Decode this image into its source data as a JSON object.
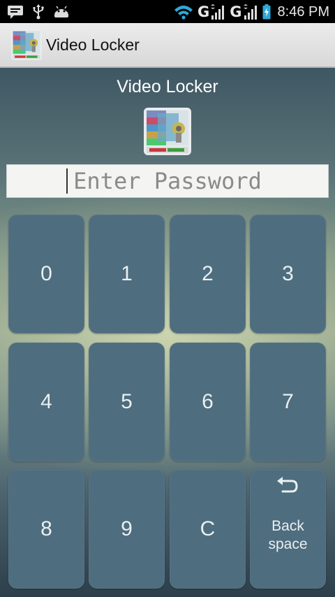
{
  "status_bar": {
    "network_1": "G",
    "network_2": "G",
    "time": "8:46 PM",
    "icons": [
      "chat-notification-icon",
      "usb-icon",
      "android-debug-icon",
      "wifi-icon",
      "signal-icon",
      "signal-icon",
      "battery-icon"
    ]
  },
  "action_bar": {
    "title": "Video Locker"
  },
  "main": {
    "title": "Video Locker",
    "password_placeholder": "Enter Password",
    "password_value": ""
  },
  "keypad": {
    "keys": [
      "0",
      "1",
      "2",
      "3",
      "4",
      "5",
      "6",
      "7",
      "8",
      "9",
      "C"
    ],
    "backspace_label": "Back space"
  },
  "colors": {
    "key_background": "#4e6d7e",
    "key_text": "#e9eff2",
    "action_bar": "#e4e4e4",
    "status_bar": "#000000"
  }
}
